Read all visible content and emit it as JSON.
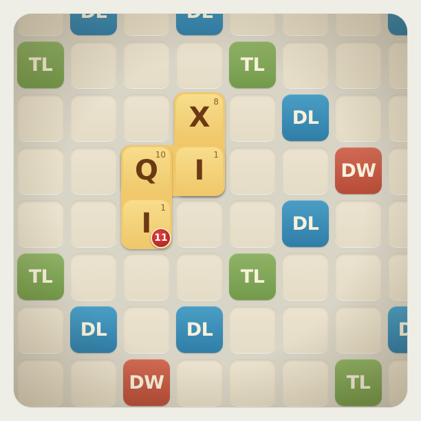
{
  "board": {
    "rows": [
      [
        "",
        "DL",
        "",
        "DL",
        "",
        "",
        "",
        "DL"
      ],
      [
        "TL",
        "",
        "",
        "",
        "TL",
        "",
        "",
        ""
      ],
      [
        "",
        "",
        "",
        "",
        "",
        "DL",
        "",
        ""
      ],
      [
        "",
        "",
        "",
        "",
        "",
        "",
        "DW",
        ""
      ],
      [
        "",
        "",
        "",
        "",
        "",
        "DL",
        "",
        ""
      ],
      [
        "TL",
        "",
        "",
        "",
        "TL",
        "",
        "",
        ""
      ],
      [
        "",
        "DL",
        "",
        "DL",
        "",
        "",
        "",
        "DL"
      ],
      [
        "",
        "",
        "DW",
        "",
        "",
        "",
        "TL",
        ""
      ]
    ]
  },
  "tiles": [
    {
      "letter": "X",
      "points": "8",
      "row": 2,
      "col": 3
    },
    {
      "letter": "Q",
      "points": "10",
      "row": 3,
      "col": 2
    },
    {
      "letter": "I",
      "points": "1",
      "row": 3,
      "col": 3
    },
    {
      "letter": "I",
      "points": "1",
      "row": 4,
      "col": 2
    }
  ],
  "score_badge": {
    "value": "11"
  },
  "colors": {
    "TL": "#7ea556",
    "DL": "#3a8db6",
    "DW": "#c45a45",
    "tile": "#f3cf73",
    "tile_letter": "#6b3a14",
    "badge": "#c12a25"
  }
}
